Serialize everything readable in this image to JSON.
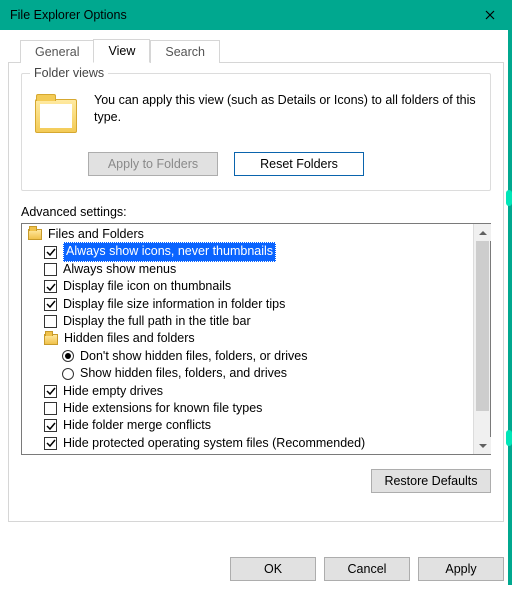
{
  "window": {
    "title": "File Explorer Options"
  },
  "tabs": {
    "general": "General",
    "view": "View",
    "search": "Search"
  },
  "folderViews": {
    "groupLabel": "Folder views",
    "text": "You can apply this view (such as Details or Icons) to all folders of this type.",
    "applyBtn": "Apply to Folders",
    "resetBtn": "Reset Folders"
  },
  "advanced": {
    "label": "Advanced settings:",
    "root": "Files and Folders",
    "items": {
      "i0": "Always show icons, never thumbnails",
      "i1": "Always show menus",
      "i2": "Display file icon on thumbnails",
      "i3": "Display file size information in folder tips",
      "i4": "Display the full path in the title bar",
      "grp": "Hidden files and folders",
      "r0": "Don't show hidden files, folders, or drives",
      "r1": "Show hidden files, folders, and drives",
      "i5": "Hide empty drives",
      "i6": "Hide extensions for known file types",
      "i7": "Hide folder merge conflicts",
      "i8": "Hide protected operating system files (Recommended)"
    }
  },
  "buttons": {
    "restore": "Restore Defaults",
    "ok": "OK",
    "cancel": "Cancel",
    "apply": "Apply"
  }
}
